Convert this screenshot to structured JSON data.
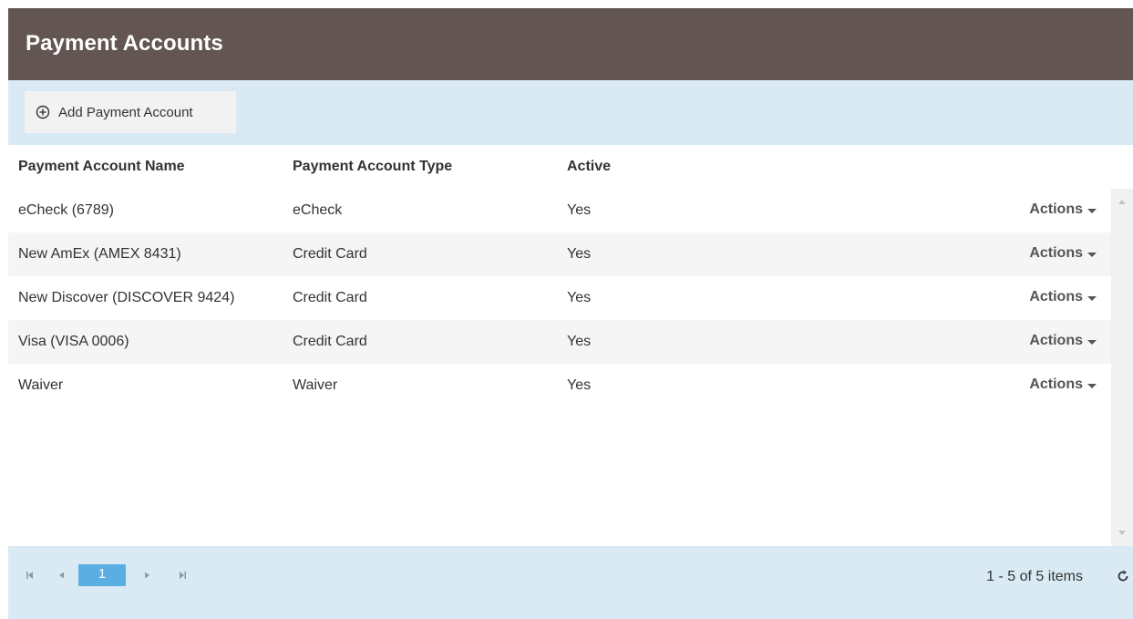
{
  "header": {
    "title": "Payment Accounts"
  },
  "toolbar": {
    "add_label": "Add Payment Account",
    "add_icon": "plus-circle-icon"
  },
  "grid": {
    "columns": [
      "Payment Account Name",
      "Payment Account Type",
      "Active"
    ],
    "rows": [
      {
        "name": "eCheck (6789)",
        "type": "eCheck",
        "active": "Yes",
        "actions": "Actions"
      },
      {
        "name": "New AmEx (AMEX 8431)",
        "type": "Credit Card",
        "active": "Yes",
        "actions": "Actions"
      },
      {
        "name": "New Discover (DISCOVER 9424)",
        "type": "Credit Card",
        "active": "Yes",
        "actions": "Actions"
      },
      {
        "name": "Visa (VISA 0006)",
        "type": "Credit Card",
        "active": "Yes",
        "actions": "Actions"
      },
      {
        "name": "Waiver",
        "type": "Waiver",
        "active": "Yes",
        "actions": "Actions"
      }
    ]
  },
  "pager": {
    "current_page": "1",
    "items_info": "1 - 5 of 5 items",
    "icons": [
      "first-page-icon",
      "prev-page-icon",
      "next-page-icon",
      "last-page-icon",
      "refresh-icon"
    ]
  },
  "colors": {
    "header_bg": "#625552",
    "toolbar_bg": "#daeaf4",
    "page_active": "#5aaee2"
  }
}
